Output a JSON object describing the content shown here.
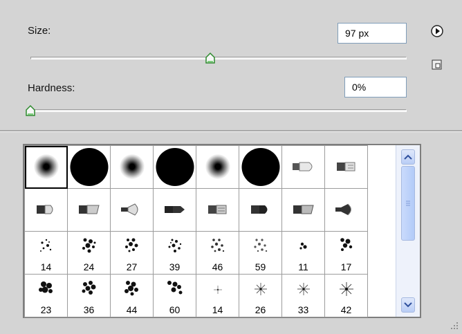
{
  "size": {
    "label": "Size:",
    "value": "97 px",
    "slider_fraction": 0.5
  },
  "hardness": {
    "label": "Hardness:",
    "value": "0%",
    "slider_fraction": 0.0
  },
  "icons": {
    "menu": "play-circle-icon",
    "new_preset": "new-preset-icon",
    "resize_grip": "resize-grip-icon"
  },
  "brushes": {
    "row1": [
      "soft-round-brush",
      "hard-round-brush",
      "soft-round-brush",
      "hard-round-brush",
      "soft-round-brush",
      "hard-round-brush",
      "bullet-brush",
      "square-brush"
    ],
    "row2": [
      "flat-brush",
      "angled-brush",
      "fan-brush",
      "chisel-brush",
      "square-flat-brush",
      "round-flat-brush",
      "angled-flat-brush",
      "wide-fan-brush"
    ],
    "row3_numbers": [
      "14",
      "24",
      "27",
      "39",
      "46",
      "59",
      "11",
      "17"
    ],
    "row4_numbers": [
      "23",
      "36",
      "44",
      "60",
      "14",
      "26",
      "33",
      "42"
    ]
  }
}
